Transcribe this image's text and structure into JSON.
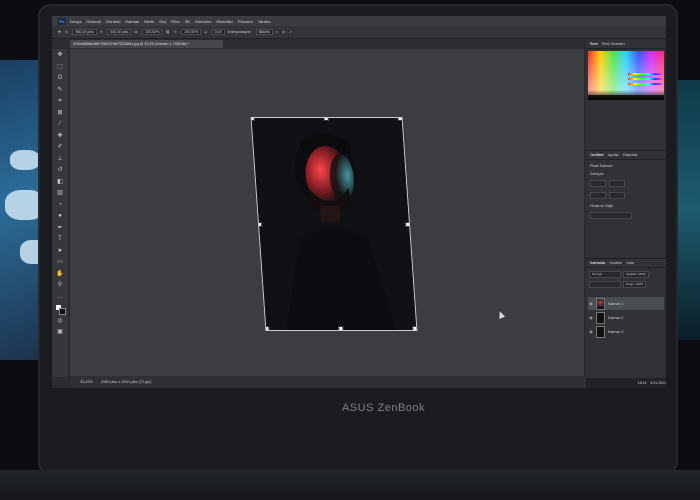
{
  "app": {
    "menu": [
      "Dosya",
      "Düzenle",
      "Görüntü",
      "Katman",
      "Metin",
      "Seç",
      "Filtre",
      "3B",
      "Görünüm",
      "Eklentiler",
      "Pencere",
      "Yardım"
    ]
  },
  "options_bar": {
    "x_value": "960,00 piks",
    "y_value": "540,00 piks",
    "w_value": "100,00%",
    "h_value": "100,00%",
    "angle_value": "0,00",
    "interpolation_label": "Enterpolasyon:",
    "interpolation_value": "Bikübik"
  },
  "document": {
    "tab_title": "9789b8888ce88f7398297b6f7332689a.jpg @ 33,3% (Katman 1, RGB/8#) *"
  },
  "status": {
    "zoom": "33,33%",
    "size": "1080 piks x 1920 piks (72 ppi)"
  },
  "panels": {
    "color_tabs": [
      "Renk",
      "Renk Örnekleri"
    ],
    "properties_tabs": [
      "Özellikler",
      "Ayarlar",
      "Kitaplıklar"
    ],
    "pixel_layer_label": "Piksel Katmanı",
    "transform_label": "Dönüştür",
    "align_label": "Hizala ve Dağıt",
    "layers_tabs": [
      "Katmanlar",
      "Kanallar",
      "Yollar"
    ],
    "blend_mode": "Normal",
    "opacity": "Opaklık: 100%",
    "fill": "Dolgu: 100%",
    "layers": [
      {
        "name": "Katman 1",
        "selected": true
      },
      {
        "name": "Katman 2",
        "selected": false
      },
      {
        "name": "Katman 3",
        "selected": false
      }
    ]
  },
  "taskbar": {
    "time": "16:13",
    "date": "5.01.2021"
  },
  "laptop": {
    "brand": "ASUS ZenBook"
  }
}
